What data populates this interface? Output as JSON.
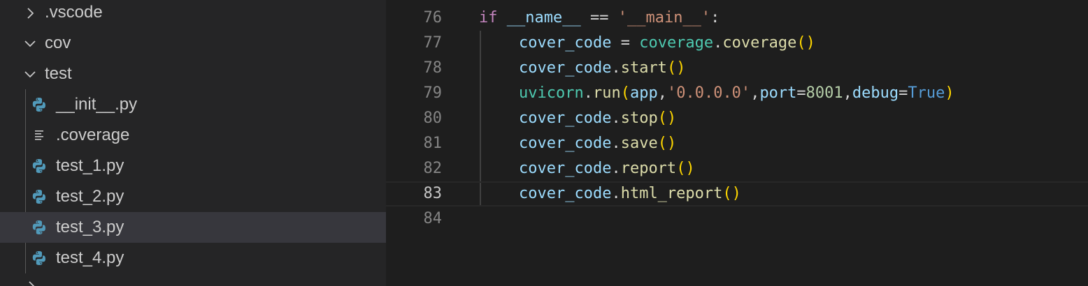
{
  "explorer": {
    "folders": [
      {
        "name": ".vscode",
        "expanded": false
      },
      {
        "name": "cov",
        "expanded": true
      },
      {
        "name": "test",
        "expanded": true
      }
    ],
    "files": [
      {
        "name": "__init__.py",
        "icon": "python-icon",
        "selected": false
      },
      {
        "name": ".coverage",
        "icon": "lines-file-icon",
        "selected": false
      },
      {
        "name": "test_1.py",
        "icon": "python-icon",
        "selected": false
      },
      {
        "name": "test_2.py",
        "icon": "python-icon",
        "selected": false
      },
      {
        "name": "test_3.py",
        "icon": "python-icon",
        "selected": true
      },
      {
        "name": "test_4.py",
        "icon": "python-icon",
        "selected": false
      }
    ]
  },
  "editor": {
    "current_line": "83",
    "lines": [
      {
        "num": "76",
        "tokens": [
          "if",
          "__name__",
          "==",
          "'__main__'",
          ":"
        ]
      },
      {
        "num": "77",
        "tokens": [
          "cover_code",
          "=",
          "coverage",
          ".",
          "coverage",
          "(",
          ")"
        ]
      },
      {
        "num": "78",
        "tokens": [
          "cover_code",
          ".",
          "start",
          "(",
          ")"
        ]
      },
      {
        "num": "79",
        "tokens": [
          "uvicorn",
          ".",
          "run",
          "(",
          "app",
          ",",
          "'0.0.0.0'",
          ",",
          "port",
          "=",
          "8001",
          ",",
          "debug",
          "=",
          "True",
          ")"
        ]
      },
      {
        "num": "80",
        "tokens": [
          "cover_code",
          ".",
          "stop",
          "(",
          ")"
        ]
      },
      {
        "num": "81",
        "tokens": [
          "cover_code",
          ".",
          "save",
          "(",
          ")"
        ]
      },
      {
        "num": "82",
        "tokens": [
          "cover_code",
          ".",
          "report",
          "(",
          ")"
        ]
      },
      {
        "num": "83",
        "tokens": [
          "cover_code",
          ".",
          "html_report",
          "(",
          ")"
        ]
      },
      {
        "num": "84",
        "tokens": []
      }
    ]
  },
  "colors": {
    "sidebar_bg": "#252526",
    "editor_bg": "#1e1e1e",
    "selection_bg": "#37373d",
    "keyword": "#c586c0",
    "variable": "#9cdcfe",
    "string": "#ce9178",
    "class": "#4ec9b0",
    "function": "#dcdcaa",
    "bracket": "#ffd700",
    "number": "#b5cea8",
    "constant": "#569cd6",
    "python_icon": "#519aba"
  }
}
